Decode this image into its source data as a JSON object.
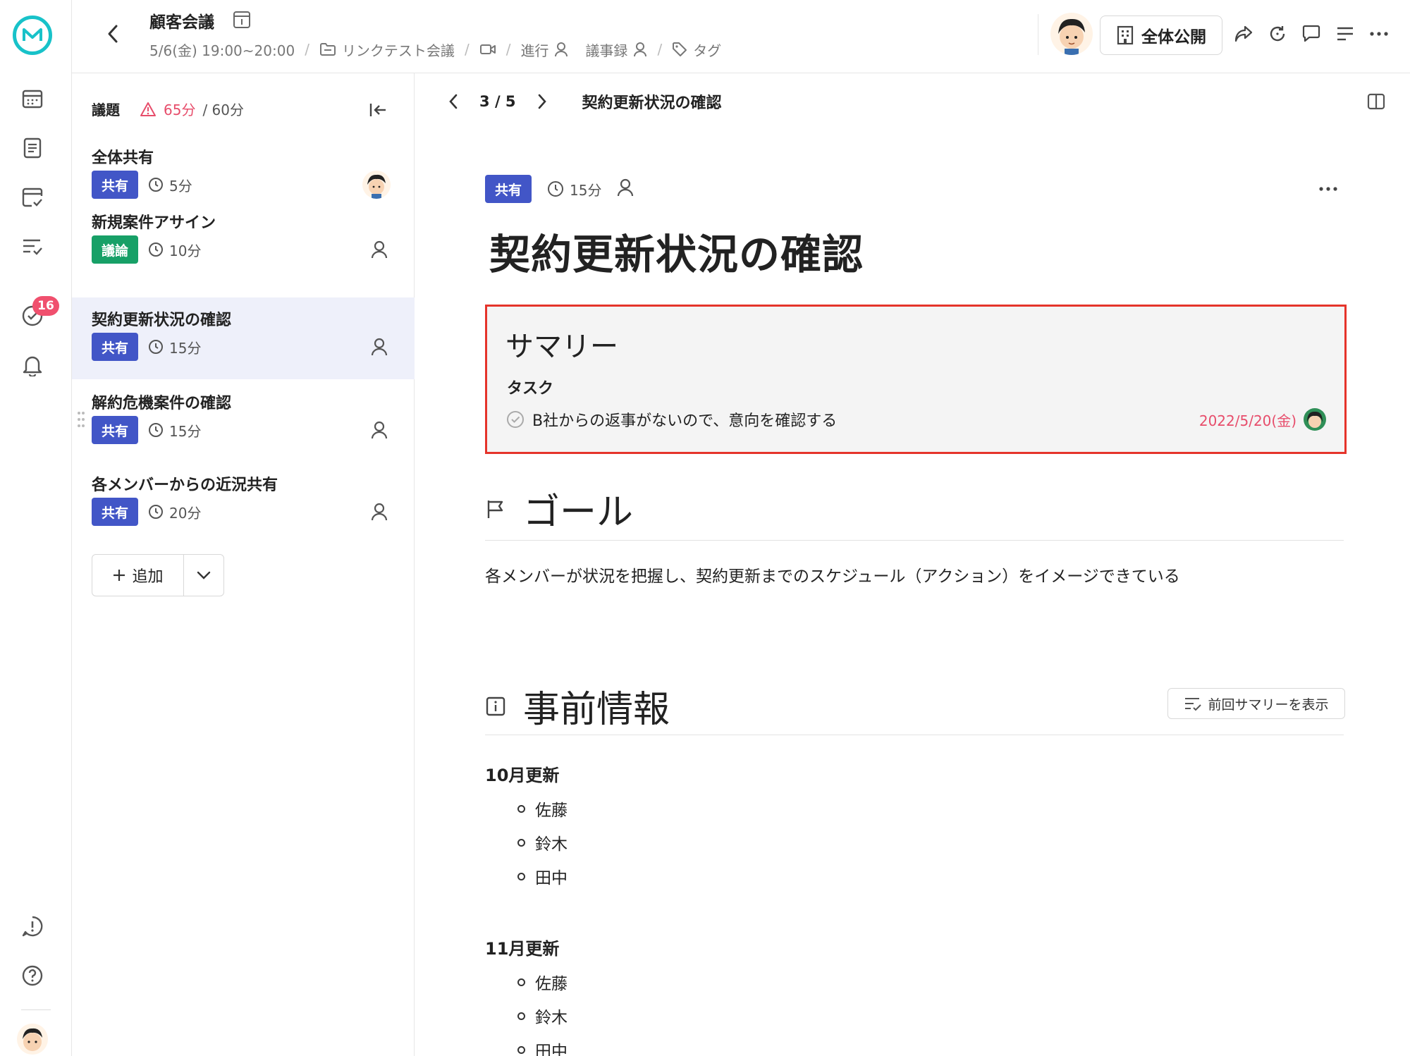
{
  "header": {
    "meeting_title": "顧客会議",
    "datetime": "5/6(金) 19:00~20:00",
    "meeting_link": "リンクテスト会議",
    "facilitator_label": "進行",
    "minutes_label": "議事録",
    "tags_label": "タグ",
    "visibility_button": "全体公開"
  },
  "rail": {
    "notification_badge": "16"
  },
  "agenda": {
    "label": "議題",
    "over_time": "65分",
    "total_time": "/ 60分",
    "items": [
      {
        "title": "全体共有",
        "tag": "共有",
        "duration": "5分"
      },
      {
        "title": "新規案件アサイン",
        "tag": "議論",
        "duration": "10分"
      },
      {
        "title": "契約更新状況の確認",
        "tag": "共有",
        "duration": "15分"
      },
      {
        "title": "解約危機案件の確認",
        "tag": "共有",
        "duration": "15分"
      },
      {
        "title": "各メンバーからの近況共有",
        "tag": "共有",
        "duration": "20分"
      }
    ],
    "add_button": "追加"
  },
  "main": {
    "pager": {
      "current": "3",
      "separator": "/",
      "total": "5"
    },
    "current_title": "契約更新状況の確認",
    "topic_tag": "共有",
    "topic_duration": "15分",
    "topic_title": "契約更新状況の確認",
    "summary": {
      "title": "サマリー",
      "section": "タスク",
      "task_text": "B社からの返事がないので、意向を確認する",
      "task_date": "2022/5/20(金)"
    },
    "goal": {
      "heading": "ゴール",
      "text": "各メンバーが状況を把握し、契約更新までのスケジュール（アクション）をイメージできている"
    },
    "prior_info": {
      "heading": "事前情報",
      "prev_summary_button": "前回サマリーを表示",
      "groups": [
        {
          "title": "10月更新",
          "names": [
            "佐藤",
            "鈴木",
            "田中"
          ]
        },
        {
          "title": "11月更新",
          "names": [
            "佐藤",
            "鈴木",
            "田中"
          ]
        }
      ]
    }
  },
  "colors": {
    "accent_teal": "#18c2c9",
    "share_tag": "#4256c7",
    "discuss_tag": "#17a067",
    "warning_pink": "#e74d6b",
    "highlight_red": "#e5342b",
    "active_row": "#eef0fa"
  }
}
